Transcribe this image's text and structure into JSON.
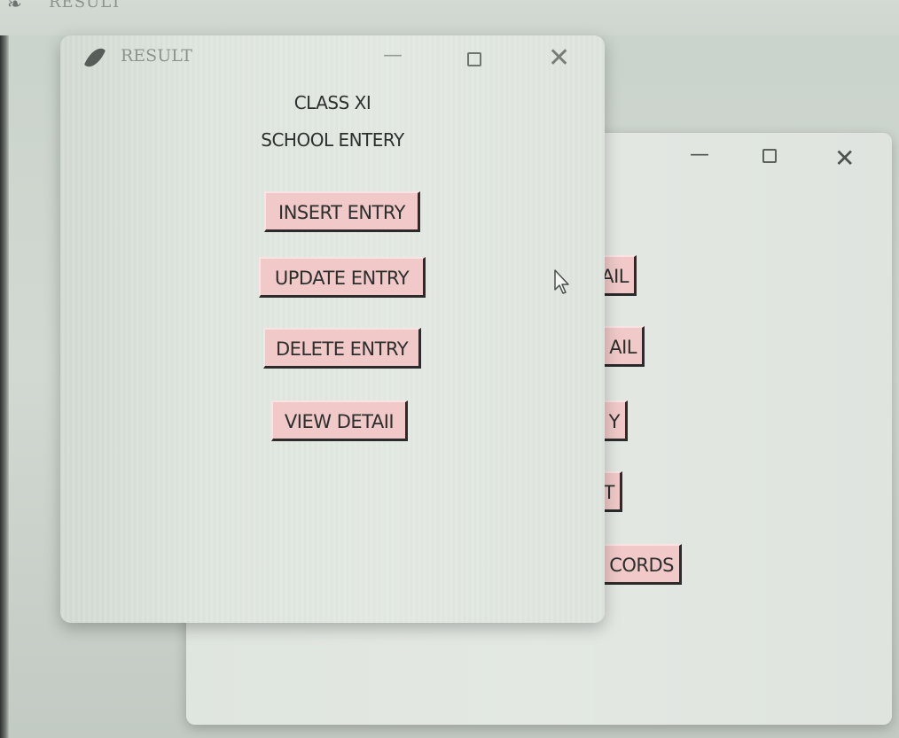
{
  "background_window": {
    "title": "RESULT",
    "buttons": [
      "AIL",
      "AIL",
      "Y",
      "T",
      "CORDS"
    ]
  },
  "front_window": {
    "title": "RESULT",
    "heading_line1": "CLASS XI",
    "heading_line2": "SCHOOL ENTERY",
    "buttons": [
      "INSERT ENTRY",
      "UPDATE ENTRY",
      "DELETE ENTRY",
      "VIEW DETAII"
    ]
  },
  "colors": {
    "button_bg": "#f0c9c8",
    "window_bg": "#e0e6e0"
  },
  "icons": [
    "feather-icon",
    "minimize-icon",
    "maximize-icon",
    "close-icon",
    "mouse-cursor-icon"
  ]
}
